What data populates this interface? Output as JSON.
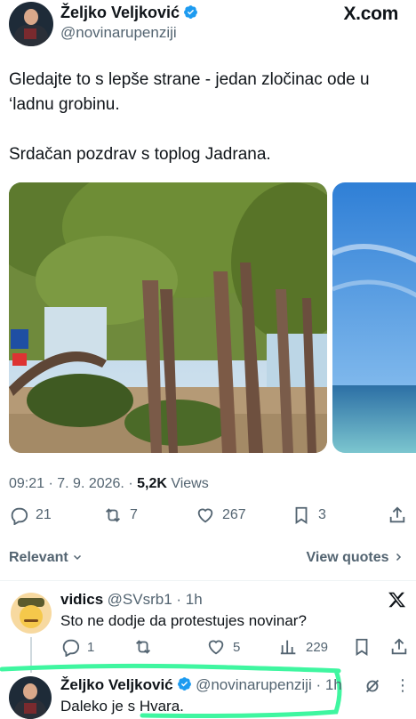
{
  "header": {
    "display_name": "Željko Veljković",
    "handle": "@novinarupenziji",
    "brand": "X.com"
  },
  "tweet": {
    "text_line1": "Gledajte to s lepše strane - jedan zločinac ode u ‘ladnu grobinu.",
    "text_line2": "Srdačan pozdrav s toplog Jadrana.",
    "time": "09:21 · 7. 9. 2026. · ",
    "views_count": "5,2K",
    "views_label": " Views"
  },
  "actions": {
    "replies": "21",
    "reposts": "7",
    "likes": "267",
    "bookmarks": "3"
  },
  "sort": {
    "relevant": "Relevant",
    "view_quotes": "View quotes"
  },
  "replies": [
    {
      "name": "vidics",
      "handle": "@SVsrb1 · 1h",
      "text": "Sto ne dodje da protestujes novinar?",
      "replies": "1",
      "likes": "5",
      "views": "229"
    },
    {
      "name": "Željko Veljković",
      "handle": "@novinarupenziji · 1h",
      "text": "Daleko je s Hvara."
    }
  ],
  "colors": {
    "verified_blue": "#1d9bf0",
    "green_marker": "#3ff6a0"
  }
}
